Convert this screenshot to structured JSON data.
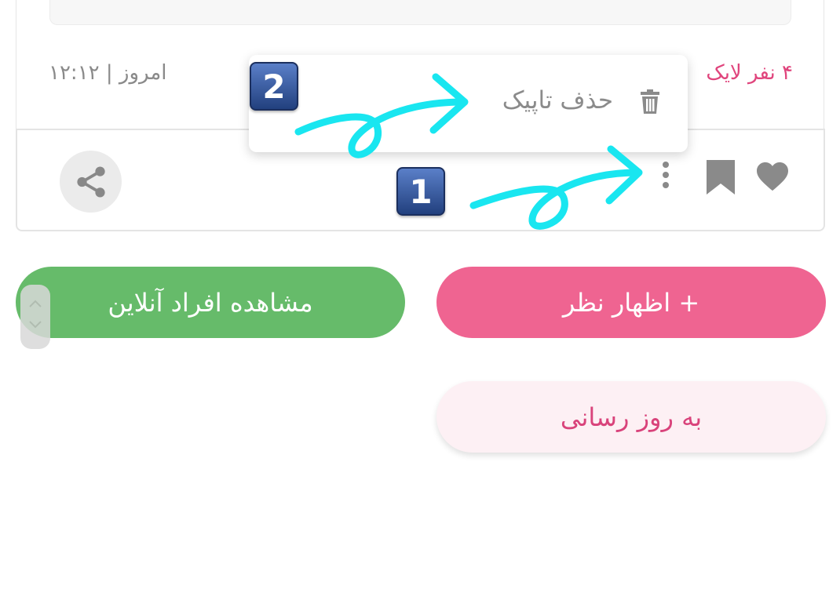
{
  "post": {
    "date_text": "امروز | ۱۲:۱۲",
    "likes_text": "۴ نفر لایک"
  },
  "actions": {
    "like_icon": "heart-icon",
    "bookmark_icon": "bookmark-icon",
    "more_icon": "more-vertical-icon",
    "share_icon": "share-icon"
  },
  "popup_menu": {
    "delete_label": "حذف تاپیک",
    "delete_icon": "trash-icon"
  },
  "annotations": {
    "step1": "1",
    "step2": "2",
    "arrow_color": "#19e6f0"
  },
  "buttons": {
    "online_users": "مشاهده افراد آنلاین",
    "comment": "+ اظهار نظر",
    "refresh": "به روز رسانی"
  },
  "colors": {
    "green": "#66bb6a",
    "pink": "#ef6491",
    "pink_text": "#e0457d",
    "light_pink": "#fdf0f4"
  }
}
